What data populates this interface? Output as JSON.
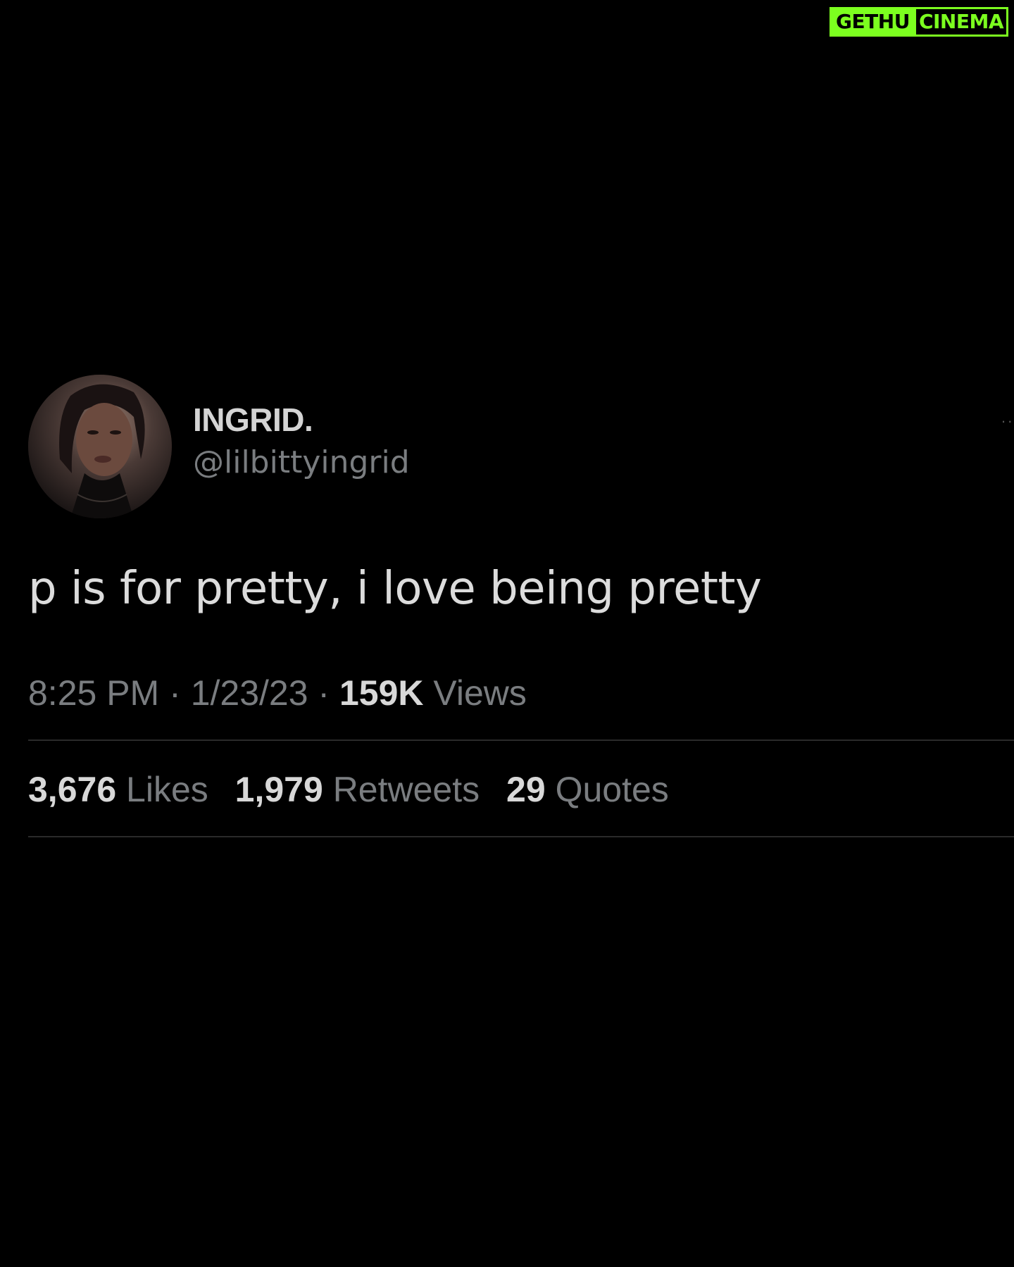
{
  "watermark": {
    "part1": "GETHU",
    "part2": "CINEMA",
    "color": "#7cff1f"
  },
  "tweet": {
    "display_name": "INGRID.",
    "handle": "@lilbittyingrid",
    "text": "p is for pretty, i love being pretty",
    "time": "8:25 PM",
    "date": "1/23/23",
    "views_count": "159K",
    "views_label": "Views",
    "separator": "·",
    "more_icon": "more-icon",
    "stats": {
      "likes_count": "3,676",
      "likes_label": "Likes",
      "retweets_count": "1,979",
      "retweets_label": "Retweets",
      "quotes_count": "29",
      "quotes_label": "Quotes"
    }
  },
  "colors": {
    "background": "#000000",
    "primary_text": "#dcdcdc",
    "secondary_text": "#7a7d80",
    "divider": "#2a2a2a"
  }
}
